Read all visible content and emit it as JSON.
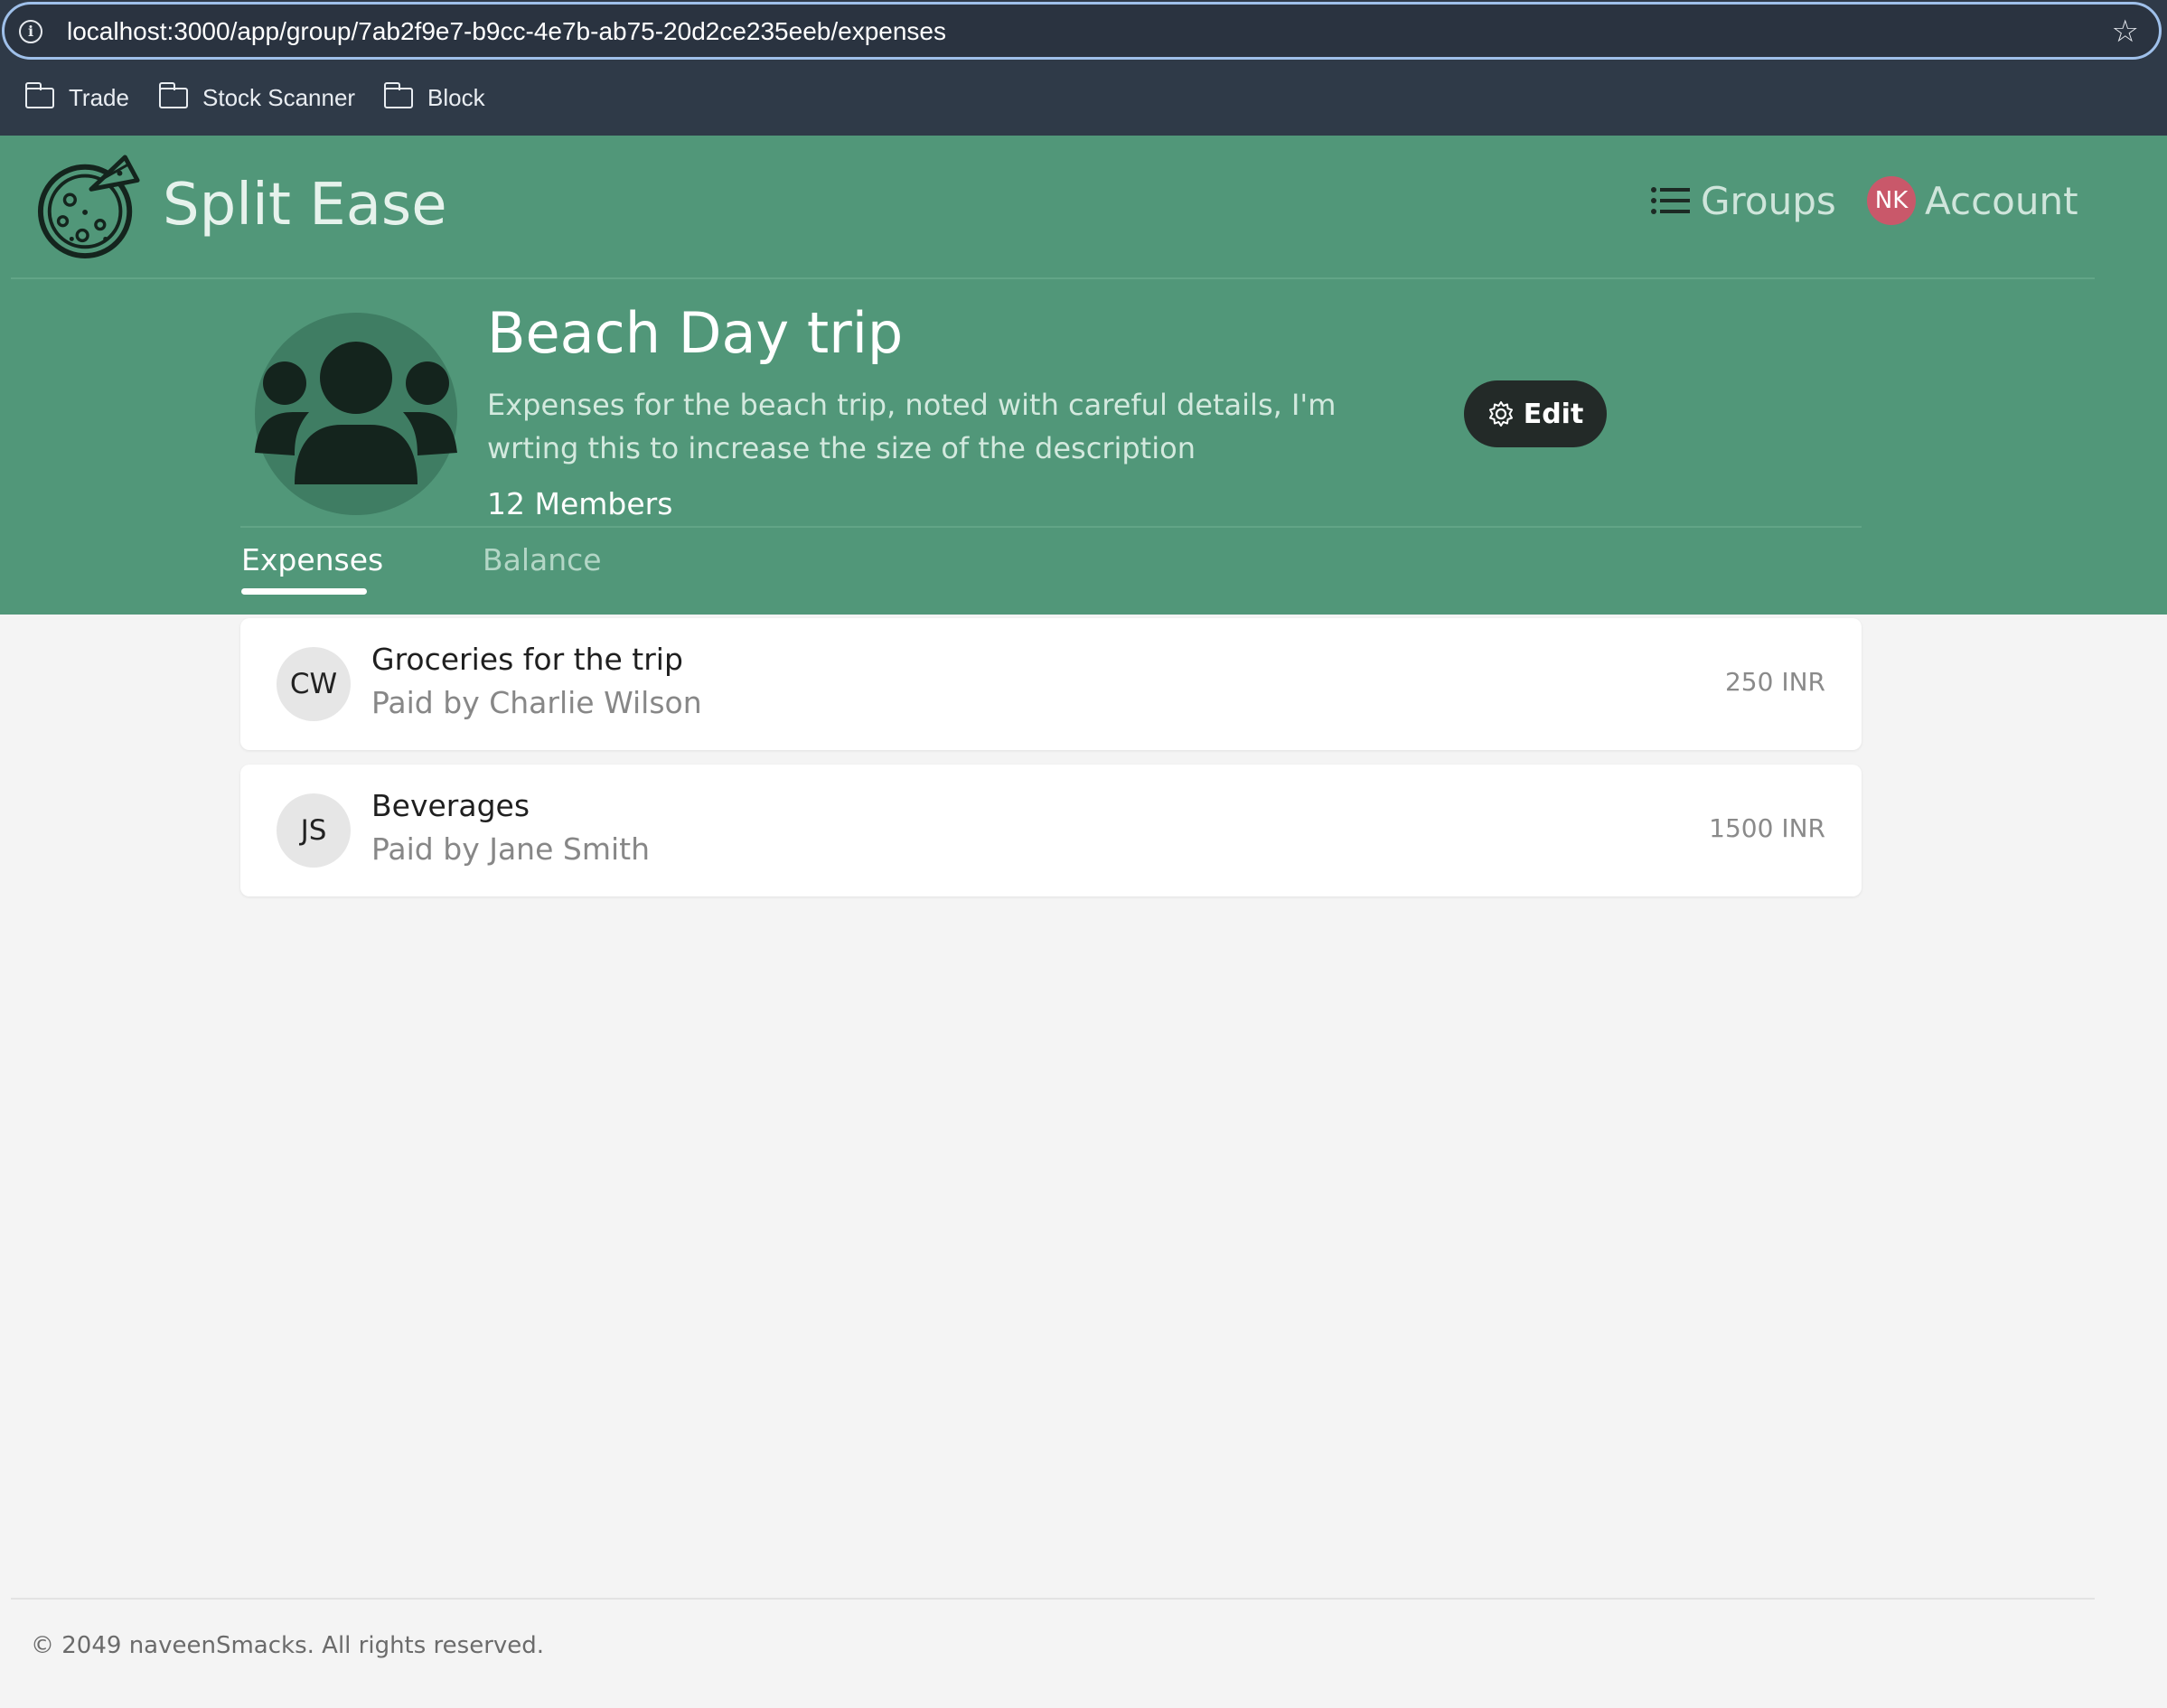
{
  "browser": {
    "url": "localhost:3000/app/group/7ab2f9e7-b9cc-4e7b-ab75-20d2ce235eeb/expenses",
    "info_icon": "info-icon",
    "star_icon": "star-icon",
    "bookmarks": [
      {
        "label": "Trade",
        "icon": "folder-icon"
      },
      {
        "label": "Stock Scanner",
        "icon": "folder-icon"
      },
      {
        "label": "Block",
        "icon": "folder-icon"
      }
    ]
  },
  "header": {
    "brand": "Split Ease",
    "logo_icon": "pizza-icon",
    "nav": {
      "groups_label": "Groups",
      "groups_icon": "list-icon",
      "account_label": "Account",
      "account_initials": "NK"
    }
  },
  "group": {
    "title": "Beach Day trip",
    "description": "Expenses for the beach trip, noted with careful details, I'm wrting this to increase the size of the description",
    "members": "12 Members",
    "edit_label": "Edit",
    "avatar_icon": "users-icon"
  },
  "tabs": [
    {
      "label": "Expenses",
      "active": true
    },
    {
      "label": "Balance",
      "active": false
    }
  ],
  "expenses": [
    {
      "initials": "CW",
      "title": "Groceries for the trip",
      "payer": "Paid by Charlie Wilson",
      "amount": "250 INR"
    },
    {
      "initials": "JS",
      "title": "Beverages",
      "payer": "Paid by Jane Smith",
      "amount": "1500 INR"
    }
  ],
  "footer": {
    "text": "© 2049 naveenSmacks. All rights reserved."
  },
  "colors": {
    "header_bg": "#519779",
    "browser_bg": "#2f3a48",
    "account_avatar": "#c9586a",
    "edit_button_bg": "#232a28"
  }
}
